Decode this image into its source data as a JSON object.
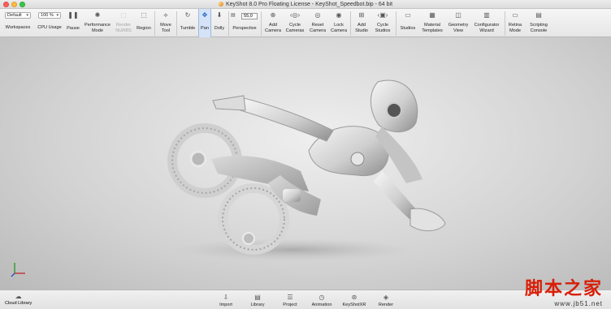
{
  "window": {
    "title": "KeyShot 8.0 Pro Floating License  - KeyShot_Speedbot.bip  - 64 bit"
  },
  "toolbar": {
    "workspaces": {
      "value": "Default",
      "label": "Workspaces"
    },
    "cpu": {
      "value": "100 %",
      "label": "CPU Usage"
    },
    "pause": {
      "label": "Pause",
      "icon": "pause-icon"
    },
    "performance": {
      "label": "Performance\nMode",
      "icon": "performance-mode-icon"
    },
    "render_nurbs": {
      "label": "Render\nNURBS",
      "icon": "nurbs-icon",
      "disabled": true
    },
    "region": {
      "label": "Region",
      "icon": "region-icon"
    },
    "move_tool": {
      "label": "Move\nTool",
      "icon": "move-tool-icon"
    },
    "tumble": {
      "label": "Tumble",
      "icon": "tumble-icon"
    },
    "pan": {
      "label": "Pan",
      "icon": "pan-icon",
      "active": true
    },
    "dolly": {
      "label": "Dolly",
      "icon": "dolly-icon"
    },
    "perspective": {
      "label": "Perspective",
      "value": "55,0"
    },
    "add_camera": {
      "label": "Add\nCamera"
    },
    "cycle_cameras": {
      "label": "Cycle\nCameras"
    },
    "reset_camera": {
      "label": "Reset\nCamera"
    },
    "lock_camera": {
      "label": "Lock\nCamera"
    },
    "add_studio": {
      "label": "Add\nStudio"
    },
    "cycle_studios": {
      "label": "Cycle\nStudios"
    },
    "studios": {
      "label": "Studios"
    },
    "material_templates": {
      "label": "Material\nTemplates"
    },
    "geometry_view": {
      "label": "Geometry\nView"
    },
    "configurator_wizard": {
      "label": "Configurator\nWizard"
    },
    "retina_mode": {
      "label": "Retina\nMode"
    },
    "scripting_console": {
      "label": "Scripting\nConsole"
    }
  },
  "bottombar": {
    "cloud_library": "Cloud Library",
    "items": [
      {
        "label": "Import",
        "icon": "import-icon"
      },
      {
        "label": "Library",
        "icon": "library-icon"
      },
      {
        "label": "Project",
        "icon": "project-icon"
      },
      {
        "label": "Animation",
        "icon": "animation-icon"
      },
      {
        "label": "KeyShotXR",
        "icon": "keyshotxr-icon"
      },
      {
        "label": "Render",
        "icon": "render-icon"
      }
    ]
  },
  "watermark": {
    "chinese": "脚本之家",
    "url": "www.jb51.net"
  },
  "colors": {
    "active_tool": "#1e62c8",
    "watermark": "#d81e06"
  }
}
